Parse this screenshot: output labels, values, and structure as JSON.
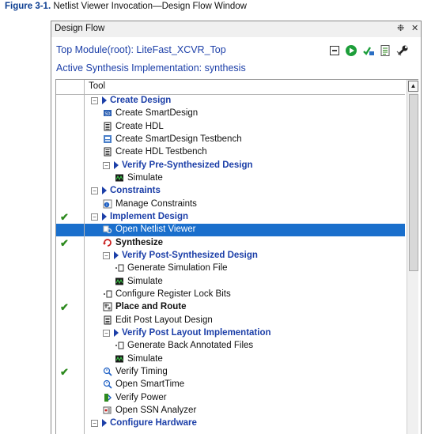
{
  "caption": {
    "label": "Figure 3-1.",
    "text": "Netlist Viewer Invocation—Design Flow Window"
  },
  "panel": {
    "title": "Design Flow",
    "restore_icon": "restore-icon",
    "close_icon": "close-icon",
    "restore_glyph": "❉",
    "close_glyph": "✕",
    "top_module": "Top Module(root): LiteFast_XCVR_Top",
    "active_impl": "Active Synthesis Implementation: synthesis"
  },
  "toolbar": [
    {
      "name": "collapse-all-icon"
    },
    {
      "name": "run-icon"
    },
    {
      "name": "verify-flow-icon"
    },
    {
      "name": "report-icon"
    },
    {
      "name": "options-wrench-icon"
    }
  ],
  "tree": {
    "column_header": "Tool",
    "items": [
      {
        "label": "Create Design",
        "type": "category",
        "icon": "expand-triangle-icon"
      },
      {
        "label": "Create SmartDesign",
        "type": "tool",
        "icon": "smartdesign-icon"
      },
      {
        "label": "Create HDL",
        "type": "tool",
        "icon": "document-icon"
      },
      {
        "label": "Create SmartDesign Testbench",
        "type": "tool",
        "icon": "smartdesign-testbench-icon"
      },
      {
        "label": "Create HDL Testbench",
        "type": "tool",
        "icon": "document-icon"
      },
      {
        "label": "Verify Pre-Synthesized Design",
        "type": "category",
        "icon": "expand-triangle-icon"
      },
      {
        "label": "Simulate",
        "type": "tool",
        "icon": "simulate-icon"
      },
      {
        "label": "Constraints",
        "type": "category",
        "icon": "expand-triangle-icon"
      },
      {
        "label": "Manage Constraints",
        "type": "tool",
        "icon": "constraints-icon"
      },
      {
        "label": "Implement Design",
        "type": "category",
        "icon": "expand-triangle-icon",
        "checked": true
      },
      {
        "label": "Open Netlist Viewer",
        "type": "tool",
        "icon": "netlist-viewer-icon",
        "selected": true
      },
      {
        "label": "Synthesize",
        "type": "tool-strong",
        "icon": "synthesize-icon",
        "checked": true
      },
      {
        "label": "Verify Post-Synthesized Design",
        "type": "category",
        "icon": "expand-triangle-icon"
      },
      {
        "label": "Generate Simulation File",
        "type": "tool",
        "icon": "generate-file-icon"
      },
      {
        "label": "Simulate",
        "type": "tool",
        "icon": "simulate-icon"
      },
      {
        "label": "Configure Register Lock Bits",
        "type": "tool",
        "icon": "generate-file-icon"
      },
      {
        "label": "Place and Route",
        "type": "tool-strong",
        "icon": "place-route-icon",
        "checked": true
      },
      {
        "label": "Edit Post Layout Design",
        "type": "tool",
        "icon": "document-icon"
      },
      {
        "label": "Verify Post Layout Implementation",
        "type": "category",
        "icon": "expand-triangle-icon"
      },
      {
        "label": "Generate Back Annotated Files",
        "type": "tool",
        "icon": "generate-file-icon"
      },
      {
        "label": "Simulate",
        "type": "tool",
        "icon": "simulate-icon"
      },
      {
        "label": "Verify Timing",
        "type": "tool",
        "icon": "timing-icon",
        "checked": true
      },
      {
        "label": "Open SmartTime",
        "type": "tool",
        "icon": "timing-icon"
      },
      {
        "label": "Verify Power",
        "type": "tool",
        "icon": "power-icon"
      },
      {
        "label": "Open SSN Analyzer",
        "type": "tool",
        "icon": "ssn-icon"
      },
      {
        "label": "Configure Hardware",
        "type": "category",
        "icon": "expand-triangle-icon"
      }
    ]
  },
  "colors": {
    "link_blue": "#1c3fa8",
    "selection": "#1a6fcc",
    "check_green": "#2d8a1e"
  }
}
